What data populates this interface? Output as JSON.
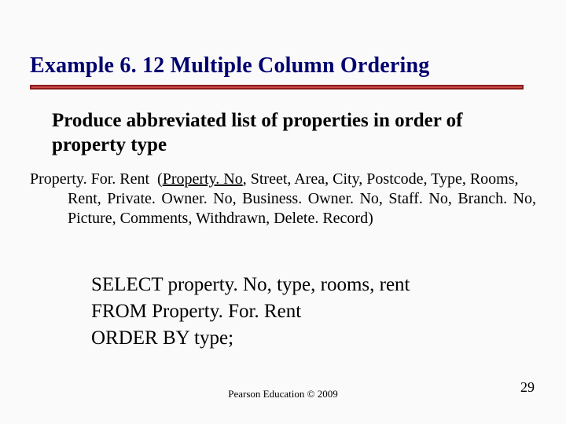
{
  "title": "Example 6. 12  Multiple Column Ordering",
  "subtitle": "Produce abbreviated list of properties in order of property type",
  "schema": {
    "relation": "Property. For. Rent",
    "pk": "Property. No",
    "rest_line1": ",  Street,  Area,  City,  Postcode,  Type,  Rooms,",
    "cont": "Rent,  Private. Owner. No,  Business. Owner. No,  Staff. No,  Branch. No,  Picture, Comments, Withdrawn, Delete. Record)"
  },
  "sql": {
    "l1": "SELECT property. No, type, rooms, rent",
    "l2": "FROM Property. For. Rent",
    "l3": "ORDER BY type;"
  },
  "footer": "Pearson Education © 2009",
  "page": "29"
}
